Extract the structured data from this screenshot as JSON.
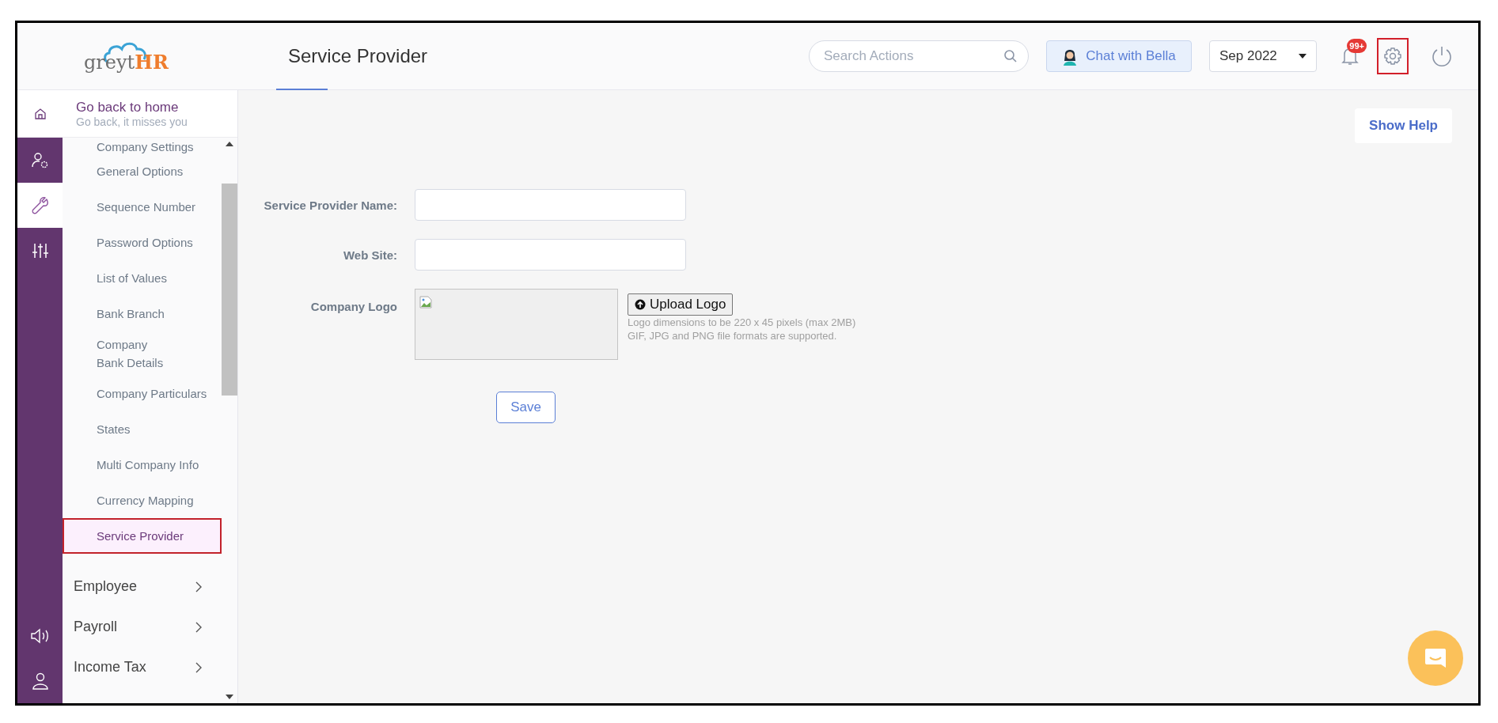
{
  "logo": {
    "text_main": "greyt",
    "text_accent": "HR"
  },
  "header": {
    "title": "Service Provider",
    "search": {
      "placeholder": "Search Actions"
    },
    "chat_button": "Chat with Bella",
    "period": "Sep 2022",
    "notification_badge": "99+",
    "settings_highlighted": true
  },
  "home_link": {
    "title": "Go back to home",
    "subtitle": "Go back, it misses you"
  },
  "rail": [
    {
      "kind": "user-settings",
      "selected": false
    },
    {
      "kind": "wrench",
      "selected": true
    },
    {
      "kind": "sliders",
      "selected": false
    }
  ],
  "rail_bottom": [
    {
      "kind": "speaker"
    },
    {
      "kind": "user"
    }
  ],
  "sidebar": {
    "items": [
      {
        "label": "Company Settings",
        "selected": false
      },
      {
        "label": "General Options",
        "selected": false
      },
      {
        "label": "Sequence Number",
        "selected": false
      },
      {
        "label": "Password Options",
        "selected": false
      },
      {
        "label": "List of Values",
        "selected": false
      },
      {
        "label": "Bank Branch",
        "selected": false
      },
      {
        "label": "Company Bank Details",
        "selected": false
      },
      {
        "label": "Company Particulars",
        "selected": false
      },
      {
        "label": "States",
        "selected": false
      },
      {
        "label": "Multi Company Info",
        "selected": false
      },
      {
        "label": "Currency Mapping",
        "selected": false
      },
      {
        "label": "Service Provider",
        "selected": true
      }
    ],
    "sections": [
      {
        "label": "Employee"
      },
      {
        "label": "Payroll"
      },
      {
        "label": "Income Tax"
      }
    ]
  },
  "show_help": "Show Help",
  "form": {
    "fields": [
      {
        "label": "Service Provider Name:"
      },
      {
        "label": "Web Site:"
      }
    ],
    "logo": {
      "label": "Company Logo",
      "upload_button": "Upload Logo",
      "hints": [
        "Logo dimensions to be 220 x 45 pixels (max 2MB)",
        "GIF, JPG and PNG file formats are supported."
      ]
    },
    "save_button": "Save"
  }
}
